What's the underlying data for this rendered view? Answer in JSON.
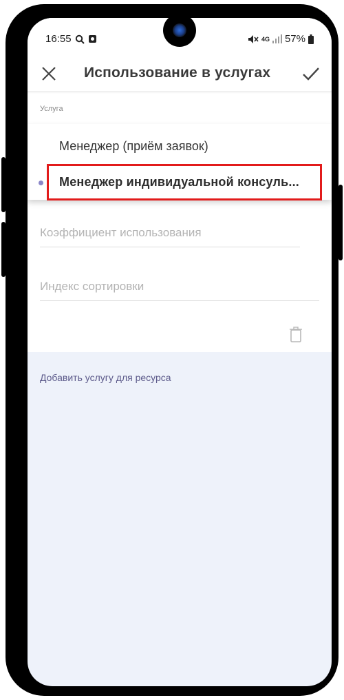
{
  "status_bar": {
    "time": "16:55",
    "network": "4G",
    "battery": "57%"
  },
  "app_bar": {
    "title": "Использование в услугах",
    "close_icon": "close-icon",
    "confirm_icon": "check-icon"
  },
  "form": {
    "service_label": "Услуга",
    "coefficient_placeholder": "Коэффициент использования",
    "sort_index_placeholder": "Индекс сортировки",
    "delete_icon": "trash-icon"
  },
  "dropdown": {
    "items": [
      {
        "label": "Менеджер (приём заявок)",
        "selected": false
      },
      {
        "label": "Менеджер индивидуальной консуль...",
        "selected": true
      }
    ]
  },
  "add_service_link": "Добавить услугу для ресурса",
  "colors": {
    "highlight": "#e21b1b",
    "accent": "#8a86c8",
    "link": "#5c5a8a",
    "background": "#eef2fa"
  }
}
